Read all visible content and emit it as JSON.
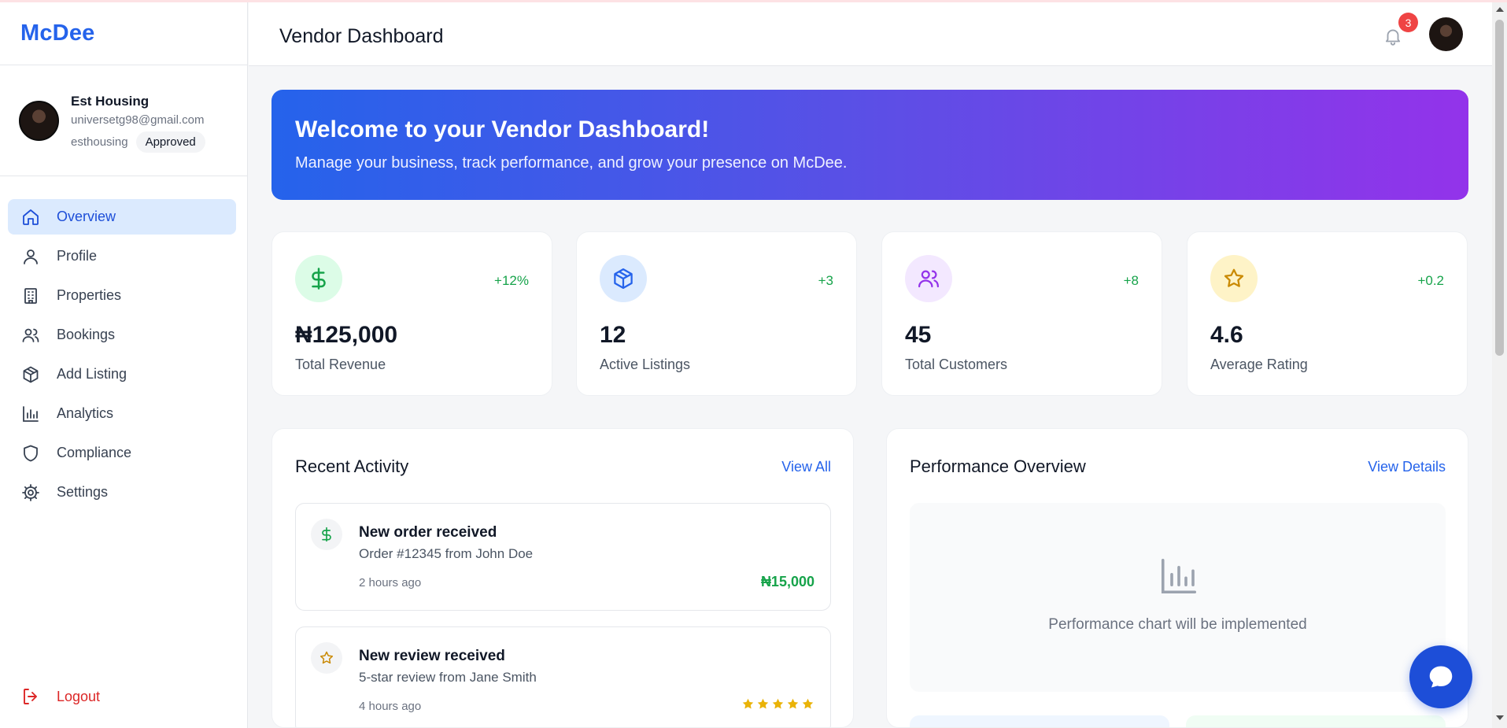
{
  "app": {
    "brand": "McDee",
    "accent": "#2563eb"
  },
  "header": {
    "title": "Vendor Dashboard",
    "notification_count": "3"
  },
  "user": {
    "name": "Est Housing",
    "email": "universetg98@gmail.com",
    "username": "esthousing",
    "status": "Approved"
  },
  "nav": {
    "items": [
      {
        "label": "Overview",
        "icon": "home-icon",
        "active": true
      },
      {
        "label": "Profile",
        "icon": "user-icon"
      },
      {
        "label": "Properties",
        "icon": "building-icon"
      },
      {
        "label": "Bookings",
        "icon": "users-icon"
      },
      {
        "label": "Add Listing",
        "icon": "package-icon"
      },
      {
        "label": "Analytics",
        "icon": "bar-chart-icon"
      },
      {
        "label": "Compliance",
        "icon": "shield-icon"
      },
      {
        "label": "Settings",
        "icon": "gear-icon"
      }
    ],
    "logout": "Logout"
  },
  "banner": {
    "title": "Welcome to your Vendor Dashboard!",
    "subtitle": "Manage your business, track performance, and grow your presence on McDee."
  },
  "stats": [
    {
      "value": "₦125,000",
      "label": "Total Revenue",
      "change": "+12%",
      "icon": "dollar-icon",
      "color": "#16a34a"
    },
    {
      "value": "12",
      "label": "Active Listings",
      "change": "+3",
      "icon": "package-icon",
      "color": "#2563eb"
    },
    {
      "value": "45",
      "label": "Total Customers",
      "change": "+8",
      "icon": "users-icon",
      "color": "#9333ea"
    },
    {
      "value": "4.6",
      "label": "Average Rating",
      "change": "+0.2",
      "icon": "star-icon",
      "color": "#ca8a04"
    }
  ],
  "recent_activity": {
    "title": "Recent Activity",
    "link": "View All",
    "items": [
      {
        "title": "New order received",
        "description": "Order #12345 from John Doe",
        "time": "2 hours ago",
        "amount": "₦15,000",
        "icon": "dollar-icon"
      },
      {
        "title": "New review received",
        "description": "5-star review from Jane Smith",
        "time": "4 hours ago",
        "rating": 5,
        "icon": "star-icon"
      }
    ]
  },
  "performance": {
    "title": "Performance Overview",
    "link": "View Details",
    "placeholder": "Performance chart will be implemented",
    "icon": "bar-chart-icon"
  }
}
